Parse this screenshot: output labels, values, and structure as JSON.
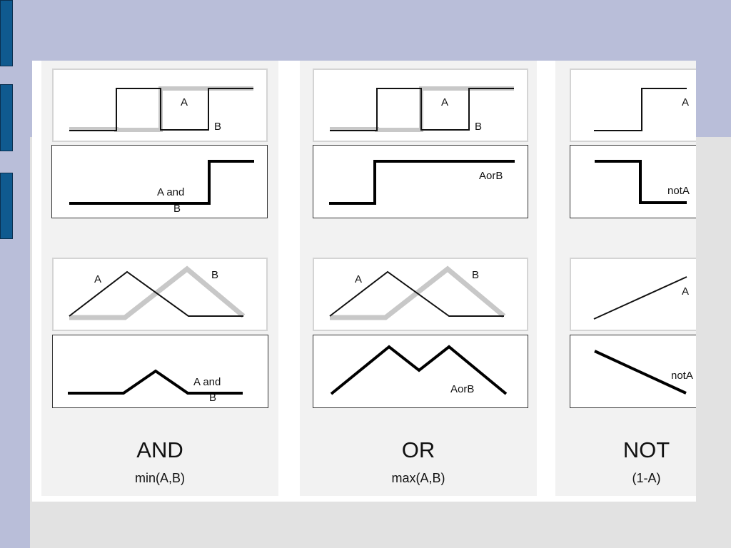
{
  "slide": {
    "columns": [
      {
        "id": "and",
        "title": "AND",
        "formula": "min(A,B)",
        "crisp_inputs": {
          "label_a": "A",
          "label_b": "B"
        },
        "crisp_output": {
          "label_line1": "A and",
          "label_line2": "B"
        },
        "fuzzy_inputs": {
          "label_a": "A",
          "label_b": "B"
        },
        "fuzzy_output": {
          "label_line1": "A and",
          "label_line2": "B"
        }
      },
      {
        "id": "or",
        "title": "OR",
        "formula": "max(A,B)",
        "crisp_inputs": {
          "label_a": "A",
          "label_b": "B"
        },
        "crisp_output": {
          "label_line1": "AorB"
        },
        "fuzzy_inputs": {
          "label_a": "A",
          "label_b": "B"
        },
        "fuzzy_output": {
          "label_line1": "AorB"
        }
      },
      {
        "id": "not",
        "title": "NOT",
        "formula": "(1-A)",
        "crisp_inputs": {
          "label_a": "A"
        },
        "crisp_output": {
          "label_line1": "notA"
        },
        "fuzzy_inputs": {
          "label_a": "A"
        },
        "fuzzy_output": {
          "label_line1": "notA"
        }
      }
    ],
    "colors": {
      "header_band": "#b9bed9",
      "side_tabs": "#0f5a8f",
      "panel_bg": "#f2f2f2",
      "series_a": "#111111",
      "series_b": "#c8c8c8"
    }
  }
}
